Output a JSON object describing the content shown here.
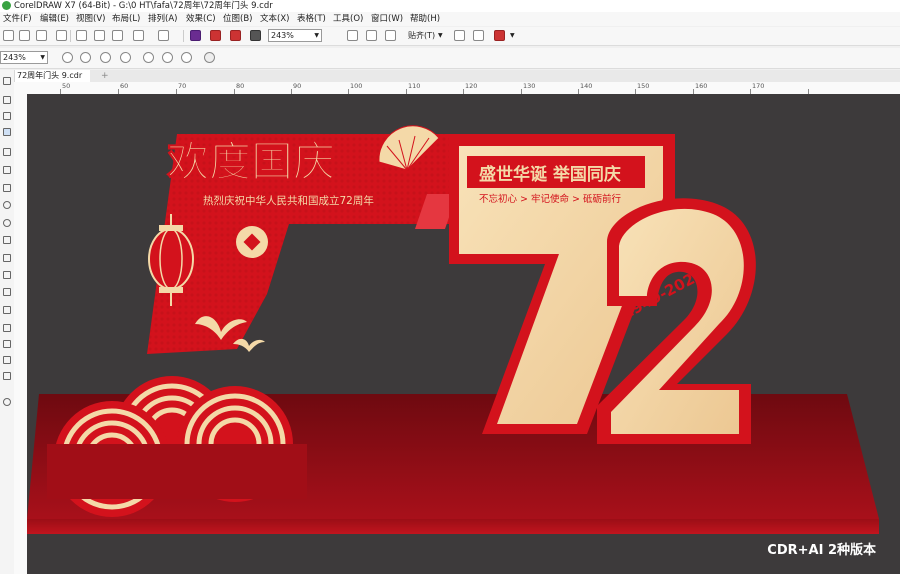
{
  "app": {
    "title": "CorelDRAW X7 (64-Bit) - G:\\0 HT\\fafa\\72周年\\72周年门头 9.cdr"
  },
  "menu": [
    "文件(F)",
    "编辑(E)",
    "视图(V)",
    "布局(L)",
    "排列(A)",
    "效果(C)",
    "位图(B)",
    "文本(X)",
    "表格(T)",
    "工具(O)",
    "窗口(W)",
    "帮助(H)"
  ],
  "toolbar": {
    "zoom_value": "243%",
    "snap_label": "贴齐(T)"
  },
  "property_bar": {
    "zoom_value": "243%"
  },
  "document_tab": {
    "label": "72周年门头 9.cdr"
  },
  "ruler": {
    "labels": [
      "50",
      "60",
      "70",
      "80",
      "90",
      "100",
      "110",
      "120",
      "130",
      "140",
      "150",
      "160",
      "170"
    ]
  },
  "design": {
    "title": "欢度国庆",
    "subtitle": "热烈庆祝中华人民共和国成立72周年",
    "slogan": "盛世华诞  举国同庆",
    "tagline": "不忘初心 > 牢记使命 > 砥砺前行",
    "years": "1949-2021",
    "number": "72"
  },
  "watermark": {
    "text": "CDR+AI 2种版本"
  },
  "colors": {
    "canvas_bg": "#3d3a3b",
    "red": "#d3121c",
    "dark_red": "#8c0a12",
    "gold": "#f4d9a8",
    "cream": "#f0d2a0"
  }
}
